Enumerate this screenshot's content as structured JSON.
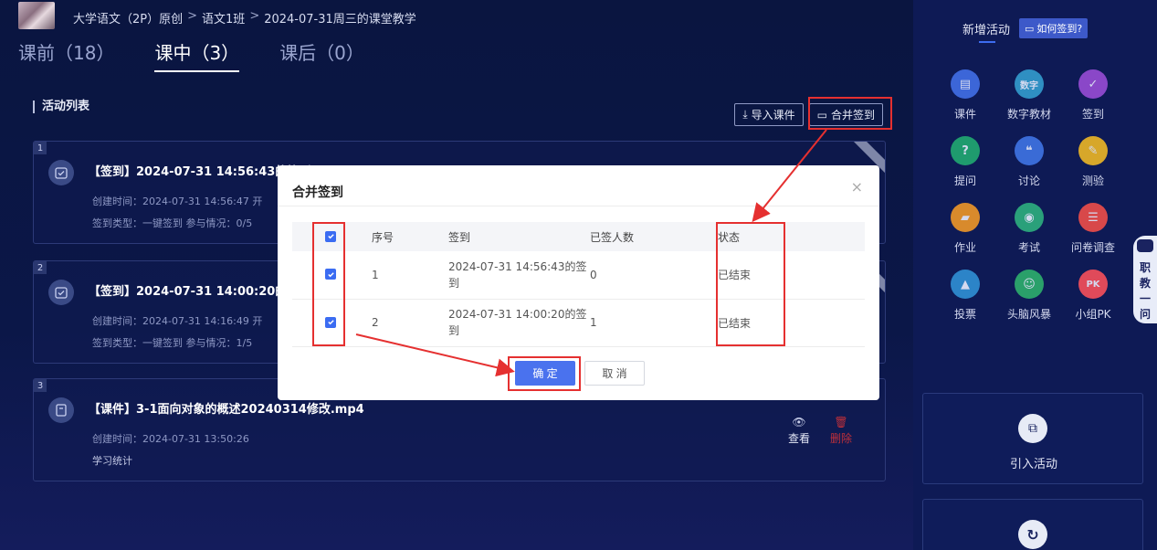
{
  "breadcrumb": [
    "大学语文（2P）原创",
    "语文1班",
    "2024-07-31周三的课堂教学"
  ],
  "tabs": [
    {
      "label": "课前（18）",
      "active": false
    },
    {
      "label": "课中（3）",
      "active": true
    },
    {
      "label": "课后（0）",
      "active": false
    }
  ],
  "list": {
    "title": "活动列表",
    "import_label": "导入课件",
    "merge_label": "合并签到"
  },
  "cards": [
    {
      "num": "1",
      "title": "【签到】2024-07-31 14:56:43的签到",
      "meta1": "创建时间：2024-07-31 14:56:47    开",
      "meta2": "签到类型：一键签到     参与情况：0/5"
    },
    {
      "num": "2",
      "title": "【签到】2024-07-31 14:00:20的签到",
      "meta1": "创建时间：2024-07-31 14:16:49    开",
      "meta2": "签到类型：一键签到     参与情况：1/5"
    },
    {
      "num": "3",
      "title": "【课件】3-1面向对象的概述20240314修改.mp4",
      "meta1": "创建时间：2024-07-31 13:50:26",
      "meta2": "学习统计",
      "view_label": "查看",
      "delete_label": "删除"
    }
  ],
  "sidebar": {
    "new_label": "新增活动",
    "how_label": "如何签到?",
    "items": [
      {
        "label": "课件",
        "icon": "courseware-icon",
        "color": "#3c66d8",
        "glyph": "▤"
      },
      {
        "label": "数字教材",
        "icon": "textbook-icon",
        "color": "#2f8fc2",
        "glyph": "数字"
      },
      {
        "label": "签到",
        "icon": "signin-icon",
        "color": "#8a47c8",
        "glyph": "✓"
      },
      {
        "label": "提问",
        "icon": "question-icon",
        "color": "#1f9b6e",
        "glyph": "?"
      },
      {
        "label": "讨论",
        "icon": "discussion-icon",
        "color": "#3a6bd6",
        "glyph": "❝"
      },
      {
        "label": "测验",
        "icon": "quiz-icon",
        "color": "#d7a72a",
        "glyph": "✎"
      },
      {
        "label": "作业",
        "icon": "homework-icon",
        "color": "#d88a2c",
        "glyph": "▰"
      },
      {
        "label": "考试",
        "icon": "exam-icon",
        "color": "#2aa07a",
        "glyph": "◉"
      },
      {
        "label": "问卷调查",
        "icon": "survey-icon",
        "color": "#d8484a",
        "glyph": "☰"
      },
      {
        "label": "投票",
        "icon": "vote-icon",
        "color": "#2c84c8",
        "glyph": "▲"
      },
      {
        "label": "头脑风暴",
        "icon": "brainstorm-icon",
        "color": "#2aa06a",
        "glyph": "☺"
      },
      {
        "label": "小组PK",
        "icon": "pk-icon",
        "color": "#e04a5a",
        "glyph": "PK"
      }
    ],
    "import_activity": "引入活动",
    "robot_label": [
      "职",
      "教",
      "一",
      "问"
    ]
  },
  "modal": {
    "title": "合并签到",
    "columns": [
      "序号",
      "签到",
      "已签人数",
      "状态"
    ],
    "rows": [
      {
        "index": "1",
        "name_l1": "2024-07-31 14:56:43的签",
        "name_l2": "到",
        "count": "0",
        "status": "已结束"
      },
      {
        "index": "2",
        "name_l1": "2024-07-31 14:00:20的签",
        "name_l2": "到",
        "count": "1",
        "status": "已结束"
      }
    ],
    "confirm": "确 定",
    "cancel": "取 消"
  }
}
